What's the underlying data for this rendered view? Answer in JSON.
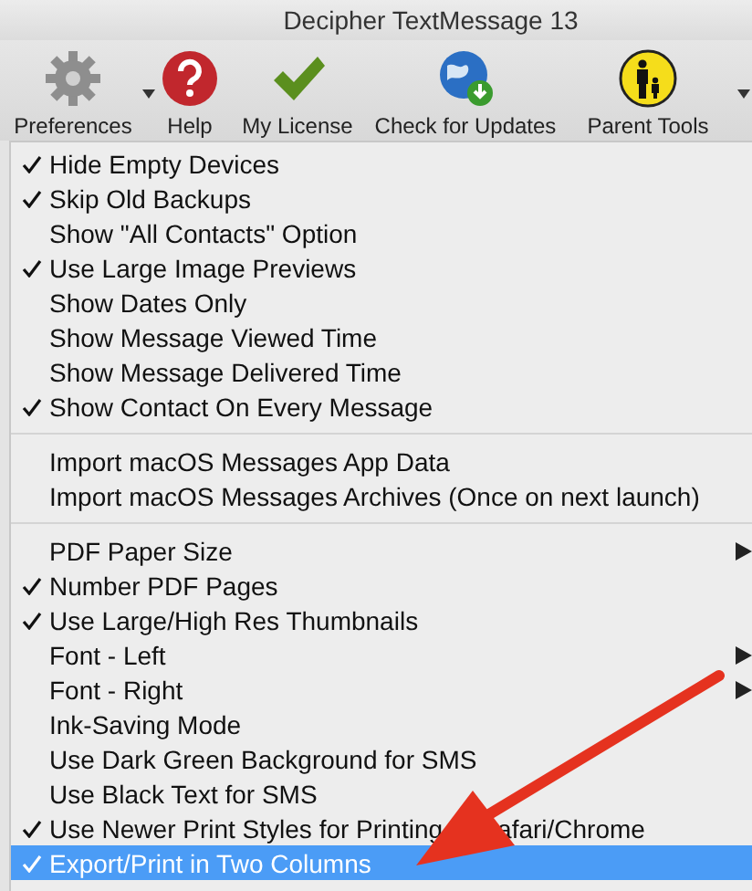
{
  "window": {
    "title": "Decipher TextMessage 13"
  },
  "toolbar": [
    {
      "label": "Preferences",
      "kind": "gear",
      "dropdown": true
    },
    {
      "label": "Help",
      "kind": "help",
      "dropdown": false
    },
    {
      "label": "My License",
      "kind": "check",
      "dropdown": false
    },
    {
      "label": "Check for Updates",
      "kind": "globe",
      "dropdown": false
    },
    {
      "label": "Parent Tools",
      "kind": "parent",
      "dropdown": true
    }
  ],
  "menu": {
    "sections": [
      {
        "items": [
          {
            "label": "Hide Empty Devices",
            "checked": true,
            "submenu": false,
            "selected": false
          },
          {
            "label": "Skip Old Backups",
            "checked": true,
            "submenu": false,
            "selected": false
          },
          {
            "label": "Show \"All Contacts\" Option",
            "checked": false,
            "submenu": false,
            "selected": false
          },
          {
            "label": "Use Large Image Previews",
            "checked": true,
            "submenu": false,
            "selected": false
          },
          {
            "label": "Show Dates Only",
            "checked": false,
            "submenu": false,
            "selected": false
          },
          {
            "label": "Show Message Viewed Time",
            "checked": false,
            "submenu": false,
            "selected": false
          },
          {
            "label": "Show Message Delivered Time",
            "checked": false,
            "submenu": false,
            "selected": false
          },
          {
            "label": "Show Contact On Every Message",
            "checked": true,
            "submenu": false,
            "selected": false
          }
        ]
      },
      {
        "items": [
          {
            "label": "Import macOS Messages App Data",
            "checked": false,
            "submenu": false,
            "selected": false
          },
          {
            "label": "Import macOS Messages Archives (Once on next launch)",
            "checked": false,
            "submenu": false,
            "selected": false
          }
        ]
      },
      {
        "items": [
          {
            "label": "PDF Paper Size",
            "checked": false,
            "submenu": true,
            "selected": false
          },
          {
            "label": "Number PDF Pages",
            "checked": true,
            "submenu": false,
            "selected": false
          },
          {
            "label": "Use Large/High Res Thumbnails",
            "checked": true,
            "submenu": false,
            "selected": false
          },
          {
            "label": "Font - Left",
            "checked": false,
            "submenu": true,
            "selected": false
          },
          {
            "label": "Font - Right",
            "checked": false,
            "submenu": true,
            "selected": false
          },
          {
            "label": "Ink-Saving Mode",
            "checked": false,
            "submenu": false,
            "selected": false
          },
          {
            "label": "Use Dark Green Background for SMS",
            "checked": false,
            "submenu": false,
            "selected": false
          },
          {
            "label": "Use Black Text for SMS",
            "checked": false,
            "submenu": false,
            "selected": false
          },
          {
            "label": "Use Newer Print Styles for Printing",
            "label_tail": "afari/Chrome",
            "checked": true,
            "submenu": false,
            "selected": false
          },
          {
            "label": "Export/Print in Two Columns",
            "checked": true,
            "submenu": false,
            "selected": true
          }
        ]
      }
    ]
  }
}
